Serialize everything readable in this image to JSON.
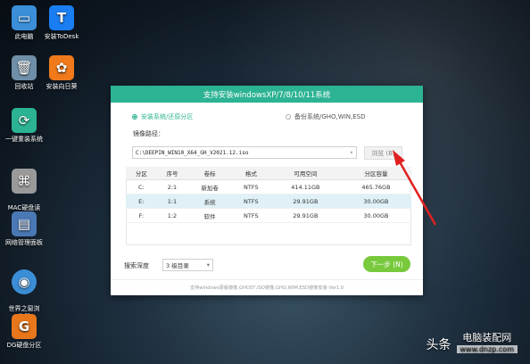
{
  "desktop": {
    "icons": [
      {
        "label": "此电脑",
        "icon": "computer-icon",
        "color": "#3a8fd8"
      },
      {
        "label": "安装ToDesk",
        "icon": "todesk-icon",
        "color": "#1a7ef2"
      },
      {
        "label": "回收站",
        "icon": "recycle-bin-icon",
        "color": "#6f8fa8"
      },
      {
        "label": "安装向日葵",
        "icon": "sunflower-icon",
        "color": "#f07a1b"
      },
      {
        "label": "一键重装系统",
        "icon": "reinstall-icon",
        "color": "#2cb393"
      },
      {
        "label": "MAC硬盘读\n取软件",
        "icon": "mac-drive-icon",
        "color": "#9a9a9a"
      },
      {
        "label": "网络管理面板",
        "icon": "network-panel-icon",
        "color": "#4a78b5"
      },
      {
        "label": "世界之窗浏\n览器",
        "icon": "browser-icon",
        "color": "#3b8ed6"
      },
      {
        "label": "DG硬盘分区",
        "icon": "diskgenius-icon",
        "color": "#e8771c"
      }
    ]
  },
  "window": {
    "title": "支持安装windowsXP/7/8/10/11系统",
    "radio_install": "安装系统/还原分区",
    "radio_backup": "备份系统/GHO,WIN,ESD",
    "path_label": "镜像路径：",
    "path_value": "C:\\DEEPIN_WIN10_X64_GH_V2021.12.iso",
    "browse_label": "浏览 (B)",
    "table": {
      "headers": [
        "分区",
        "序号",
        "卷标",
        "格式",
        "可用空间",
        "分区容量"
      ],
      "rows": [
        [
          "C:",
          "2:1",
          "新加卷",
          "NTFS",
          "414.11GB",
          "465.76GB"
        ],
        [
          "E:",
          "1:1",
          "系统",
          "NTFS",
          "29.91GB",
          "30.00GB"
        ],
        [
          "F:",
          "1:2",
          "软件",
          "NTFS",
          "29.91GB",
          "30.00GB"
        ]
      ],
      "highlight_row": 1
    },
    "depth_label": "搜索深度",
    "depth_value": "3 级目录",
    "next_label": "下一步 (N)",
    "footer": "支持windows原版镜像,GHOST,ISO镜像,GHO,WIM,ESD镜像安装 Ver1.0"
  },
  "watermark": {
    "left": "头条",
    "right": "电脑装配网",
    "url": "www.dnzp.com"
  },
  "colors": {
    "accent": "#2cb393",
    "next_button": "#78c93c",
    "arrow": "#e02020"
  }
}
